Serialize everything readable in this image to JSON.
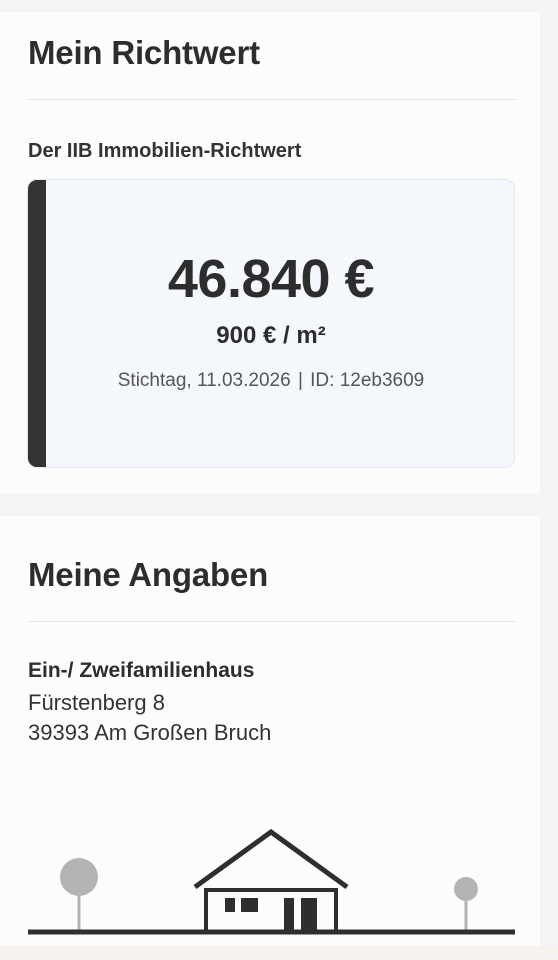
{
  "richtwert": {
    "title": "Mein Richtwert",
    "subtitle": "Der IIB Immobilien-Richtwert",
    "price": "46.840 €",
    "price_per_sqm": "900 € / m²",
    "stichtag": "Stichtag, 11.03.2026",
    "separator": "|",
    "id": "ID: 12eb3609"
  },
  "angaben": {
    "title": "Meine Angaben",
    "property_type": "Ein-/ Zweifamilienhaus",
    "street": "Fürstenberg 8",
    "city": "39393 Am Großen Bruch"
  },
  "icons": {
    "illustration": "house-with-trees-illustration"
  },
  "colors": {
    "accent": "#333333",
    "box_bg": "#f4f7fc",
    "tree": "#b3b3b5"
  }
}
